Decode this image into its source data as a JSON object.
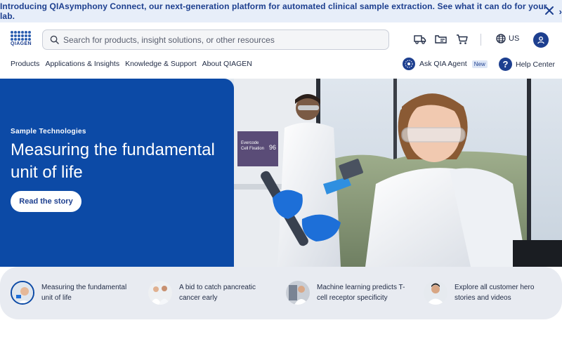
{
  "announcement": {
    "text": "Introducing QIAsymphony Connect, our next-generation platform for automated clinical sample extraction. See what it can do for your lab.",
    "chevron": "›"
  },
  "header": {
    "logo_text": "QIAGEN",
    "search_placeholder": "Search for products, insight solutions, or other resources",
    "region_label": "US"
  },
  "nav": {
    "items": [
      {
        "label": "Products"
      },
      {
        "label": "Applications & Insights"
      },
      {
        "label": "Knowledge & Support"
      },
      {
        "label": "About QIAGEN"
      }
    ],
    "agent_label": "Ask QIA Agent",
    "agent_badge": "New",
    "help_label": "Help Center"
  },
  "hero": {
    "eyebrow": "Sample Technologies",
    "title": "Measuring the fundamental unit of life",
    "cta_label": "Read the story",
    "plate_label_1": "Evercode",
    "plate_label_2": "Cell Fixation",
    "plate_number": "96"
  },
  "stories": [
    {
      "text": "Measuring the fundamental unit of life"
    },
    {
      "text": "A bid to catch pancreatic cancer early"
    },
    {
      "text": "Machine learning predicts T-cell receptor specificity"
    },
    {
      "text": "Explore all customer hero stories and videos"
    }
  ],
  "colors": {
    "brand_blue": "#0c4aa6",
    "announce_bg": "#e7eef9",
    "strip_bg": "#e8ebf1"
  }
}
